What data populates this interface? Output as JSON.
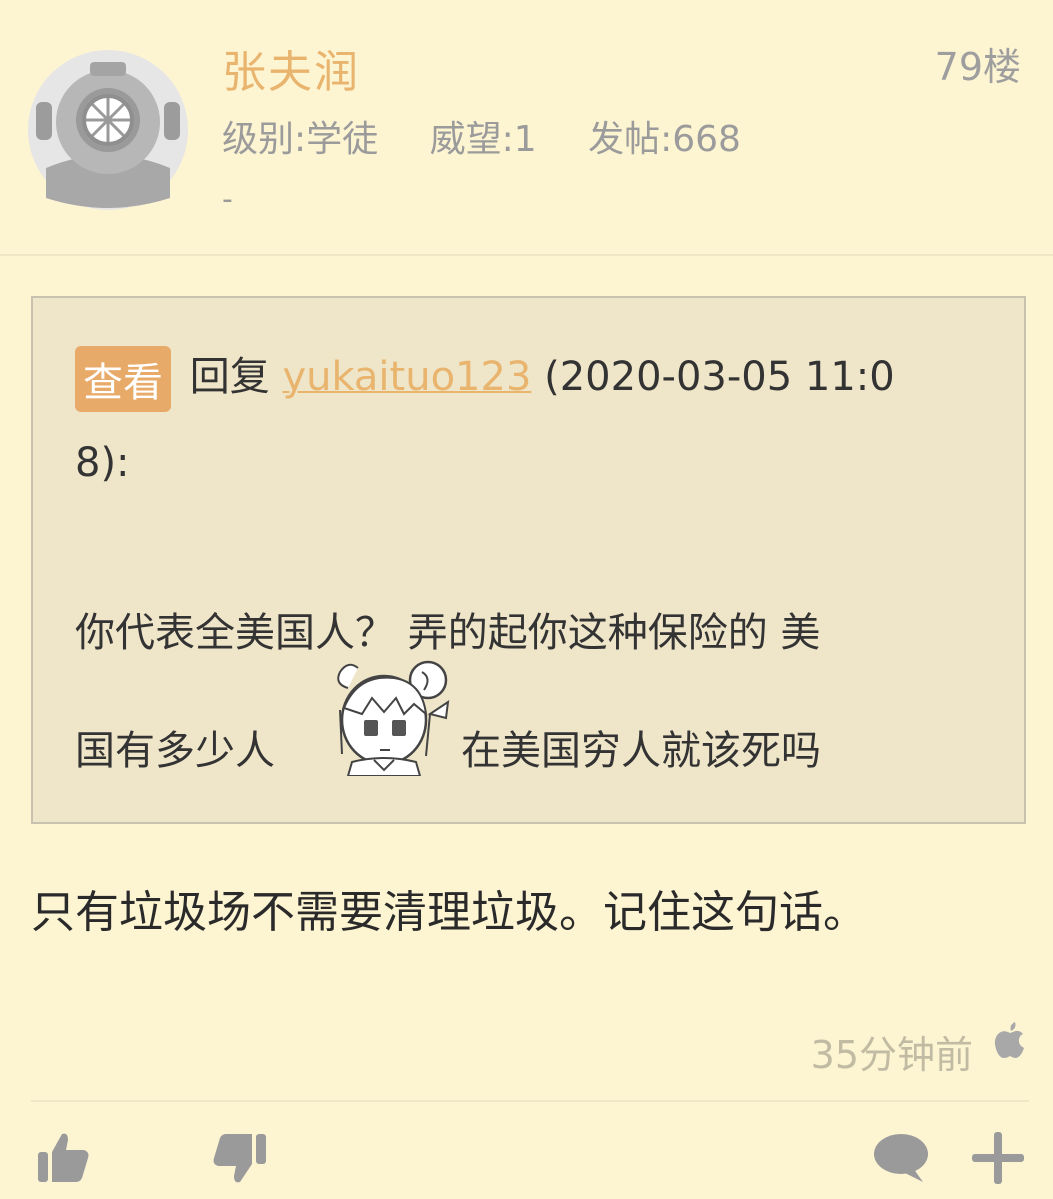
{
  "post": {
    "username": "张夫润",
    "floor": "79楼",
    "level": "级别:学徒",
    "prestige": "威望:1",
    "posts": "发帖:668",
    "signature": "-"
  },
  "quote": {
    "view_label": "查看",
    "reply_prefix": "回复",
    "reply_user": "yukaituo123",
    "reply_time_line1": "(2020-03-05 11:0",
    "reply_time_line2": "8):",
    "text_line1": "你代表全美国人？  弄的起你这种保险的 美",
    "text_line2_before": "国有多少人",
    "text_line2_after": "在美国穷人就该死吗"
  },
  "content": "只有垃圾场不需要清理垃圾。记住这句话。",
  "time": "35分钟前",
  "icons": {
    "avatar": "diving-helmet-avatar",
    "emoji": "anime-girl-sticker",
    "device": "apple-icon",
    "like": "thumbs-up-icon",
    "dislike": "thumbs-down-icon",
    "comment": "comment-bubble-icon",
    "add": "plus-icon"
  },
  "colors": {
    "background": "#fdf4d2",
    "accent": "#e8b46e",
    "quote_bg": "#efe6c9",
    "icon_gray": "#9e9e9e"
  }
}
